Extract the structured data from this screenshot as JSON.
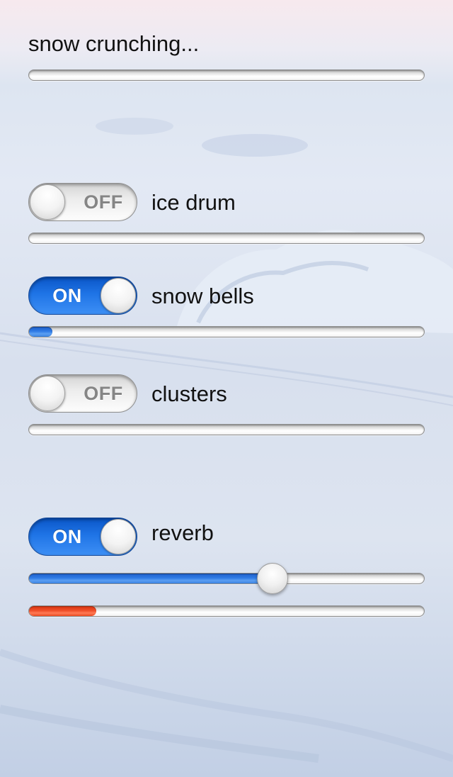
{
  "title": "snow crunching...",
  "progress": {
    "snow_crunching": 0.0,
    "ice_drum": 0.0,
    "snow_bells": 0.06,
    "clusters": 0.0,
    "reverb_level": 0.17
  },
  "reverb_slider_value": 0.615,
  "rows": {
    "ice_drum": {
      "label": "ice drum",
      "switch_text": "OFF",
      "on": false
    },
    "snow_bells": {
      "label": "snow bells",
      "switch_text": "ON",
      "on": true
    },
    "clusters": {
      "label": "clusters",
      "switch_text": "OFF",
      "on": false
    },
    "reverb": {
      "label": "reverb",
      "switch_text": "ON",
      "on": true
    }
  },
  "colors": {
    "accent_blue": "#2f7be6",
    "meter_red": "#f0502a"
  }
}
